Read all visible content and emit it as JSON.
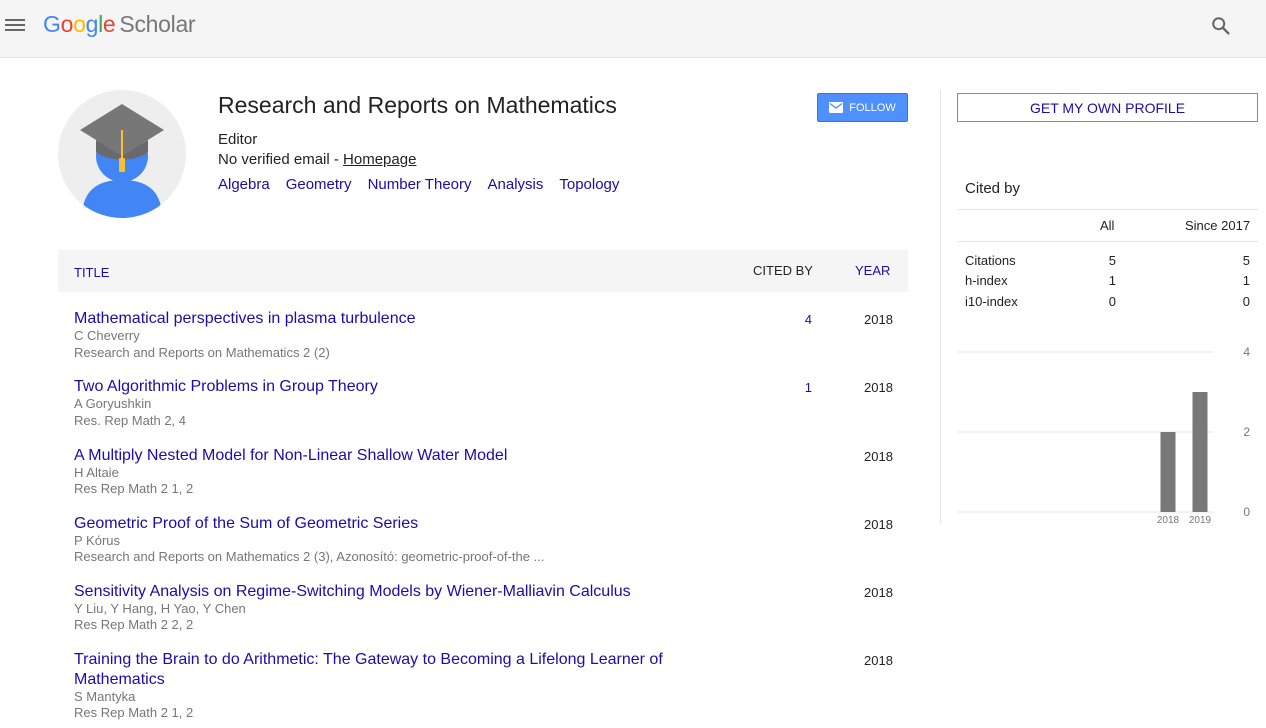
{
  "header": {
    "logo_letters": [
      "G",
      "o",
      "o",
      "g",
      "l",
      "e"
    ],
    "logo_scholar": "Scholar"
  },
  "profile": {
    "name": "Research and Reports on Mathematics",
    "affiliation": "Editor",
    "email_text": "No verified email - ",
    "homepage_label": "Homepage",
    "follow_label": "FOLLOW",
    "interests": [
      "Algebra",
      "Geometry",
      "Number Theory",
      "Analysis",
      "Topology"
    ]
  },
  "table": {
    "col_title": "TITLE",
    "col_cited": "CITED BY",
    "col_year": "YEAR",
    "rows": [
      {
        "title": "Mathematical perspectives in plasma turbulence",
        "authors": "C Cheverry",
        "venue": "Research and Reports on Mathematics 2 (2)",
        "cited": "4",
        "year": "2018"
      },
      {
        "title": "Two Algorithmic Problems in Group Theory",
        "authors": "A Goryushkin",
        "venue": "Res. Rep Math 2, 4",
        "cited": "1",
        "year": "2018"
      },
      {
        "title": "A Multiply Nested Model for Non-Linear Shallow Water Model",
        "authors": "H Altaie",
        "venue": "Res Rep Math 2 1, 2",
        "cited": "",
        "year": "2018"
      },
      {
        "title": "Geometric Proof of the Sum of Geometric Series",
        "authors": "P Kórus",
        "venue": "Research and Reports on Mathematics 2 (3), Azonosító: geometric-proof-of-the ...",
        "cited": "",
        "year": "2018"
      },
      {
        "title": "Sensitivity Analysis on Regime-Switching Models by Wiener-Malliavin Calculus",
        "authors": "Y Liu, Y Hang, H Yao, Y Chen",
        "venue": "Res Rep Math 2 2, 2",
        "cited": "",
        "year": "2018"
      },
      {
        "title": "Training the Brain to do Arithmetic: The Gateway to Becoming a Lifelong Learner of Mathematics",
        "authors": "S Mantyka",
        "venue": "Res Rep Math 2 1, 2",
        "cited": "",
        "year": "2018"
      }
    ]
  },
  "sidebar": {
    "own_profile_label": "GET MY OWN PROFILE",
    "cited_by_label": "Cited by",
    "col_all": "All",
    "col_since": "Since 2017",
    "stats": [
      {
        "label": "Citations",
        "all": "5",
        "since": "5"
      },
      {
        "label": "h-index",
        "all": "1",
        "since": "1"
      },
      {
        "label": "i10-index",
        "all": "0",
        "since": "0"
      }
    ]
  },
  "colors": {
    "link": "#1a0dab",
    "follow_bg": "#4d90fe",
    "bar": "#777777",
    "avatar_blue": "#4285f4",
    "cap": "#777777",
    "tassel": "#fbc02d"
  },
  "icons": {
    "menu": "menu-icon",
    "search": "search-icon",
    "mail": "mail-icon"
  },
  "chart_data": {
    "type": "bar",
    "categories": [
      "2018",
      "2019"
    ],
    "values": [
      2,
      3
    ],
    "ylim": [
      0,
      4
    ],
    "yticks": [
      "0",
      "2",
      "4"
    ],
    "grid": true
  }
}
